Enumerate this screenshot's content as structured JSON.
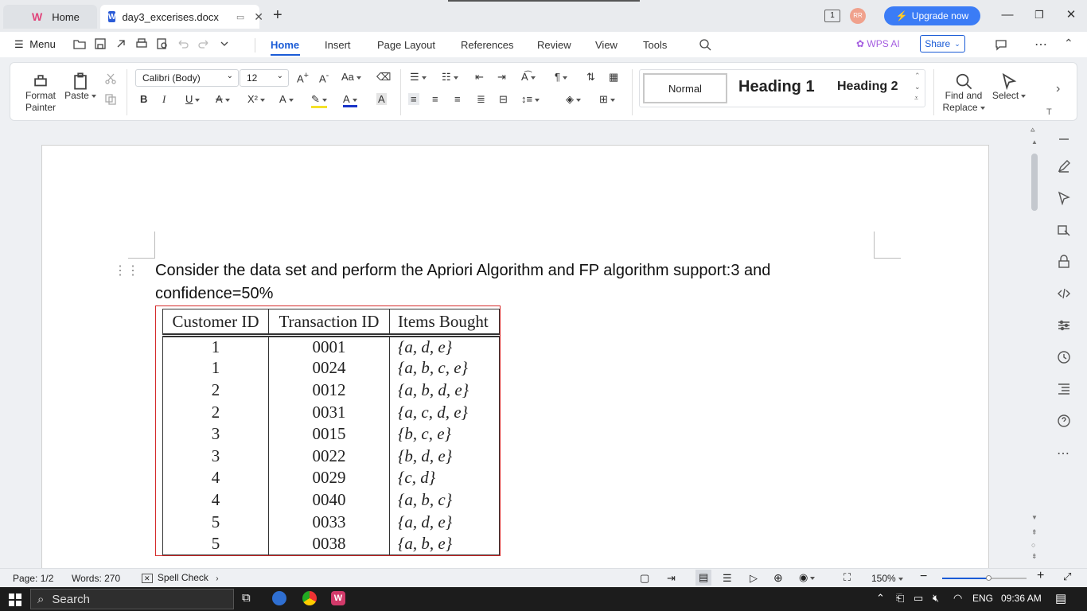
{
  "tabs": {
    "home_label": "Home",
    "doc_label": "day3_excerises.docx"
  },
  "titlebar": {
    "upgrade_label": "Upgrade now",
    "avatar_initials": "RR",
    "page_indicator": "1"
  },
  "menu": {
    "menu_label": "Menu",
    "tabs": [
      "Home",
      "Insert",
      "Page Layout",
      "References",
      "Review",
      "View",
      "Tools"
    ],
    "wps_ai_label": "WPS AI",
    "share_label": "Share"
  },
  "ribbon": {
    "format_painter_label_1": "Format",
    "format_painter_label_2": "Painter",
    "paste_label": "Paste",
    "font_name": "Calibri (Body)",
    "font_size": "12",
    "styles": [
      "Normal",
      "Heading 1",
      "Heading 2"
    ],
    "find_replace_label_1": "Find and",
    "find_replace_label_2": "Replace",
    "select_label": "Select"
  },
  "document": {
    "paragraph": "Consider the data set and perform the Apriori Algorithm and FP algorithm support:3 and confidence=50%",
    "table": {
      "headers": [
        "Customer ID",
        "Transaction ID",
        "Items Bought"
      ],
      "rows": [
        [
          "1",
          "0001",
          "{a, d, e}"
        ],
        [
          "1",
          "0024",
          "{a, b, c, e}"
        ],
        [
          "2",
          "0012",
          "{a, b, d, e}"
        ],
        [
          "2",
          "0031",
          "{a, c, d, e}"
        ],
        [
          "3",
          "0015",
          "{b, c, e}"
        ],
        [
          "3",
          "0022",
          "{b, d, e}"
        ],
        [
          "4",
          "0029",
          "{c, d}"
        ],
        [
          "4",
          "0040",
          "{a, b, c}"
        ],
        [
          "5",
          "0033",
          "{a, d, e}"
        ],
        [
          "5",
          "0038",
          "{a, b, e}"
        ]
      ]
    }
  },
  "status": {
    "page": "Page: 1/2",
    "words": "Words: 270",
    "spell_check": "Spell Check",
    "zoom": "150%"
  },
  "taskbar": {
    "search_placeholder": "Search",
    "language": "ENG",
    "time": "09:36 AM"
  },
  "colors": {
    "accent": "#1a5bd6",
    "upgrade": "#3b7cf6",
    "table_frame": "#d42a2a"
  }
}
